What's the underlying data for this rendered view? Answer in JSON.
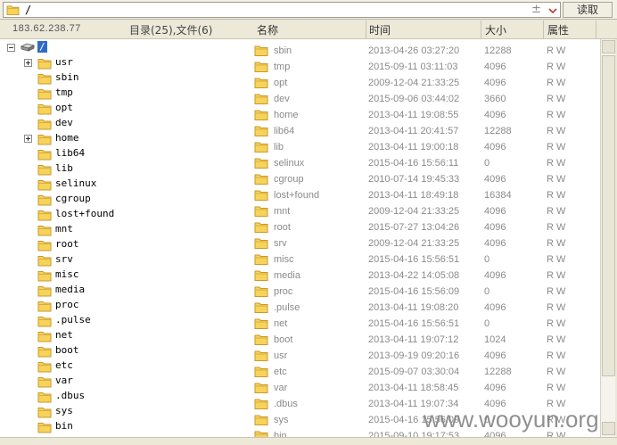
{
  "address_bar": {
    "path": "/",
    "plus_glyph": "±",
    "read_button_label": "读取"
  },
  "header": {
    "ip": "183.62.238.77",
    "counts": "目录(25),文件(6)",
    "columns": {
      "name": "名称",
      "time": "时间",
      "size": "大小",
      "attr": "属性"
    }
  },
  "tree": {
    "root": "/",
    "items": [
      {
        "label": "usr",
        "expandable": true
      },
      {
        "label": "sbin",
        "expandable": false
      },
      {
        "label": "tmp",
        "expandable": false
      },
      {
        "label": "opt",
        "expandable": false
      },
      {
        "label": "dev",
        "expandable": false
      },
      {
        "label": "home",
        "expandable": true
      },
      {
        "label": "lib64",
        "expandable": false
      },
      {
        "label": "lib",
        "expandable": false
      },
      {
        "label": "selinux",
        "expandable": false
      },
      {
        "label": "cgroup",
        "expandable": false
      },
      {
        "label": "lost+found",
        "expandable": false
      },
      {
        "label": "mnt",
        "expandable": false
      },
      {
        "label": "root",
        "expandable": false
      },
      {
        "label": "srv",
        "expandable": false
      },
      {
        "label": "misc",
        "expandable": false
      },
      {
        "label": "media",
        "expandable": false
      },
      {
        "label": "proc",
        "expandable": false
      },
      {
        "label": ".pulse",
        "expandable": false
      },
      {
        "label": "net",
        "expandable": false
      },
      {
        "label": "boot",
        "expandable": false
      },
      {
        "label": "etc",
        "expandable": false
      },
      {
        "label": "var",
        "expandable": false
      },
      {
        "label": ".dbus",
        "expandable": false
      },
      {
        "label": "sys",
        "expandable": false
      },
      {
        "label": "bin",
        "expandable": false
      }
    ]
  },
  "files": [
    {
      "name": "sbin",
      "time": "2013-04-26 03:27:20",
      "size": "12288",
      "attr": "R W"
    },
    {
      "name": "tmp",
      "time": "2015-09-11 03:11:03",
      "size": "4096",
      "attr": "R W"
    },
    {
      "name": "opt",
      "time": "2009-12-04 21:33:25",
      "size": "4096",
      "attr": "R W"
    },
    {
      "name": "dev",
      "time": "2015-09-06 03:44:02",
      "size": "3660",
      "attr": "R W"
    },
    {
      "name": "home",
      "time": "2013-04-11 19:08:55",
      "size": "4096",
      "attr": "R W"
    },
    {
      "name": "lib64",
      "time": "2013-04-11 20:41:57",
      "size": "12288",
      "attr": "R W"
    },
    {
      "name": "lib",
      "time": "2013-04-11 19:00:18",
      "size": "4096",
      "attr": "R W"
    },
    {
      "name": "selinux",
      "time": "2015-04-16 15:56:11",
      "size": "0",
      "attr": "R W"
    },
    {
      "name": "cgroup",
      "time": "2010-07-14 19:45:33",
      "size": "4096",
      "attr": "R W"
    },
    {
      "name": "lost+found",
      "time": "2013-04-11 18:49:18",
      "size": "16384",
      "attr": "R W"
    },
    {
      "name": "mnt",
      "time": "2009-12-04 21:33:25",
      "size": "4096",
      "attr": "R W"
    },
    {
      "name": "root",
      "time": "2015-07-27 13:04:26",
      "size": "4096",
      "attr": "R W"
    },
    {
      "name": "srv",
      "time": "2009-12-04 21:33:25",
      "size": "4096",
      "attr": "R W"
    },
    {
      "name": "misc",
      "time": "2015-04-16 15:56:51",
      "size": "0",
      "attr": "R W"
    },
    {
      "name": "media",
      "time": "2013-04-22 14:05:08",
      "size": "4096",
      "attr": "R W"
    },
    {
      "name": "proc",
      "time": "2015-04-16 15:56:09",
      "size": "0",
      "attr": "R W"
    },
    {
      "name": ".pulse",
      "time": "2013-04-11 19:08:20",
      "size": "4096",
      "attr": "R W"
    },
    {
      "name": "net",
      "time": "2015-04-16 15:56:51",
      "size": "0",
      "attr": "R W"
    },
    {
      "name": "boot",
      "time": "2013-04-11 19:07:12",
      "size": "1024",
      "attr": "R W"
    },
    {
      "name": "usr",
      "time": "2013-09-19 09:20:16",
      "size": "4096",
      "attr": "R W"
    },
    {
      "name": "etc",
      "time": "2015-09-07 03:30:04",
      "size": "12288",
      "attr": "R W"
    },
    {
      "name": "var",
      "time": "2013-04-11 18:58:45",
      "size": "4096",
      "attr": "R W"
    },
    {
      "name": ".dbus",
      "time": "2013-04-11 19:07:34",
      "size": "4096",
      "attr": "R W"
    },
    {
      "name": "sys",
      "time": "2015-04-16 15:56:09",
      "size": "0",
      "attr": "R W"
    },
    {
      "name": "bin",
      "time": "2015-09-10 19:17:53",
      "size": "4096",
      "attr": "R W"
    }
  ],
  "watermark": "www.wooyun.org",
  "colors": {
    "folder_fill": "#f7d35a",
    "folder_edge": "#c99a2e",
    "selection": "#316ac5",
    "list_text": "#8a8a8a"
  }
}
